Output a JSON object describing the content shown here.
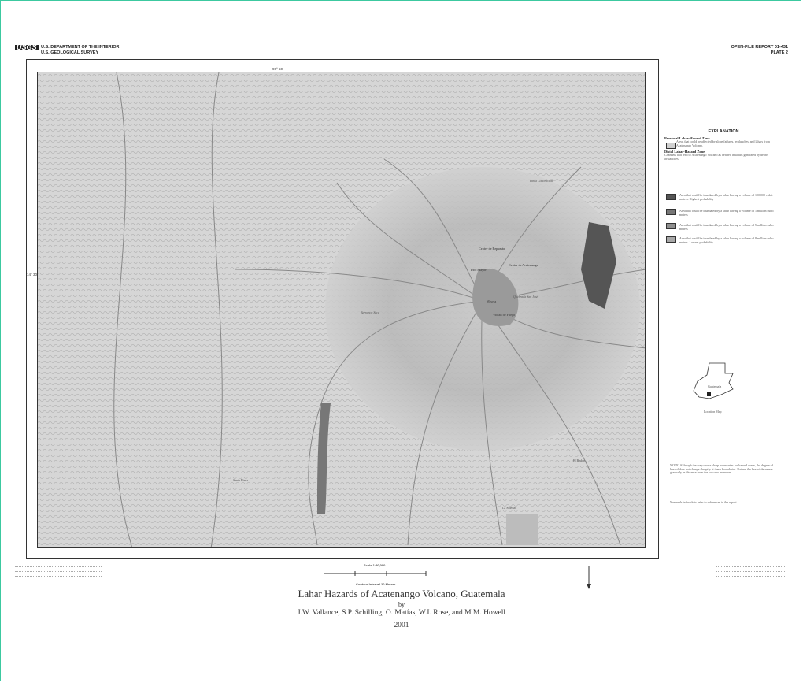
{
  "header": {
    "agency_logo": "USGS",
    "dept": "U.S. DEPARTMENT OF THE INTERIOR",
    "survey": "U.S. GEOLOGICAL SURVEY",
    "report": "OPEN-FILE REPORT 01-431",
    "plate": "PLATE 2"
  },
  "map": {
    "lon_label": "90° 50'",
    "lat_label": "14° 30'",
    "place_names": [
      "Crater de Repuesto",
      "Cráter de Acatenango",
      "Pico Mayor",
      "Meseta",
      "Volcán de Fuego",
      "Quebrada San José",
      "Santa Elena",
      "Barranca Seca",
      "El Rodeo",
      "La Soledad",
      "Finca Concepción"
    ]
  },
  "explanation": {
    "title": "EXPLANATION",
    "proximal_heading": "Proximal Lahar-Hazard Zone",
    "proximal_text": "Areas that could be affected by slope failures, avalanches, and lahars from Acatenango Volcano.",
    "distal_heading": "Distal Lahar-Hazard Zone",
    "distal_text": "Channels that lead to Acatenango Volcano as defined in lahars generated by debris avalanches.",
    "items": [
      "Area that could be inundated by a lahar having a volume of 100,000 cubic meters. Highest probability",
      "Area that could be inundated by a lahar having a volume of 1 million cubic meters",
      "Area that could be inundated by a lahar having a volume of 5 million cubic meters",
      "Area that could be inundated by a lahar having a volume of 8 million cubic meters. Lowest probability"
    ],
    "colors": [
      "#555555",
      "#777777",
      "#8f8f8f",
      "#a8a8a8"
    ],
    "location_caption": "Location Map",
    "location_country": "Guatemala",
    "note": "NOTE: Although the map shows sharp boundaries for hazard zones, the degree of hazard does not change abruptly at these boundaries. Rather, the hazard decreases gradually as distance from the volcano increases.",
    "note2": "Numerals in brackets refer to references in the report."
  },
  "footer": {
    "scale": "Scale 1:50,000",
    "contour": "Contour Interval 20 Meters",
    "title": "Lahar Hazards of Acatenango Volcano, Guatemala",
    "by": "by",
    "authors": "J.W. Vallance, S.P. Schilling, O. Matías, W.I. Rose, and M.M. Howell",
    "year": "2001"
  }
}
